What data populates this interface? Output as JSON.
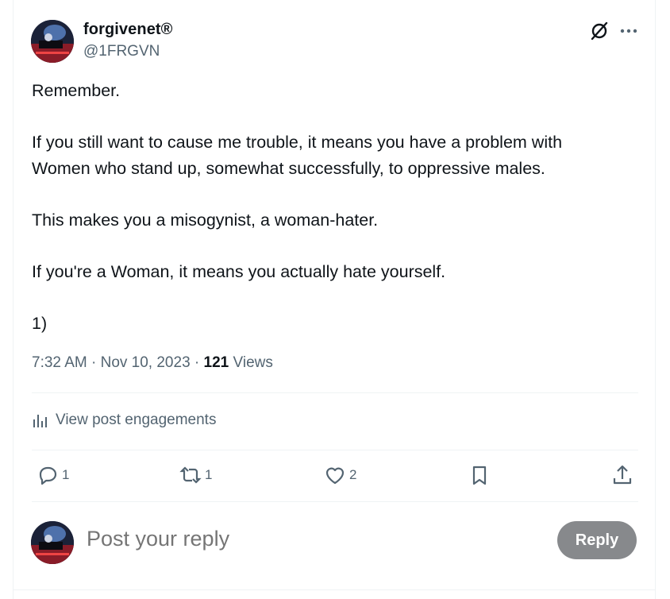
{
  "author": {
    "name": "forgivenet®",
    "handle": "@1FRGVN"
  },
  "post": {
    "paragraphs": [
      "Remember.",
      "If you still want to cause me trouble, it means you have a problem with\nWomen who stand up, somewhat successfully, to oppressive males.",
      "This makes you a misogynist, a woman-hater.",
      "If you're a Woman, it means you actually hate yourself.",
      "1)"
    ]
  },
  "meta": {
    "time": "7:32 AM",
    "separator1": " · ",
    "date": "Nov 10, 2023",
    "separator2": " · ",
    "views_count": "121",
    "views_label": " Views"
  },
  "engagements_label": "View post engagements",
  "actions": {
    "replies": "1",
    "reposts": "1",
    "likes": "2"
  },
  "reply_box": {
    "placeholder": "Post your reply",
    "button_label": "Reply"
  },
  "icons": [
    "grok-icon",
    "more-icon",
    "bar-chart-icon",
    "reply-icon",
    "repost-icon",
    "like-icon",
    "bookmark-icon",
    "share-icon"
  ],
  "colors": {
    "text": "#0f1419",
    "secondary": "#536471",
    "reply_button": "#87898c",
    "divider": "#eff3f4"
  }
}
